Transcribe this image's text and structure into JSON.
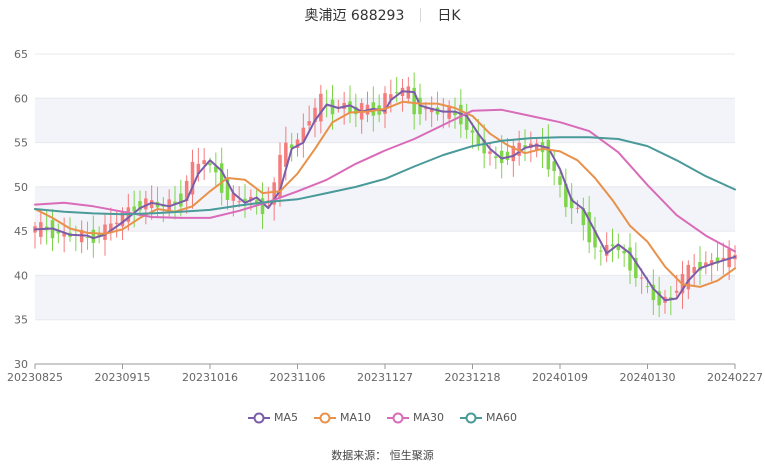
{
  "header": {
    "title": "奥浦迈 688293",
    "tab": "日K"
  },
  "source": "数据来源： 恒生聚源",
  "chart_data": {
    "type": "candlestick",
    "ylim": [
      30,
      65
    ],
    "yticks": [
      30,
      35,
      40,
      45,
      50,
      55,
      60,
      65
    ],
    "xticks": [
      "20230825",
      "20230915",
      "20231016",
      "20231106",
      "20231127",
      "20231218",
      "20240109",
      "20240130",
      "20240227"
    ],
    "xtick_index": [
      0,
      15,
      30,
      45,
      60,
      75,
      90,
      105,
      120
    ],
    "n_days": 121,
    "colors": {
      "up": "#f47c7c",
      "down": "#7ed54a",
      "ma5": "#7a5ca9",
      "ma10": "#e8914a",
      "ma30": "#d96bb9",
      "ma60": "#4a9a9a"
    },
    "series": [
      {
        "name": "MA5",
        "key": "ma5",
        "color": "#7a5ca9",
        "x": [
          0,
          3,
          6,
          9,
          10,
          12,
          15,
          18,
          20,
          23,
          26,
          28,
          30,
          32,
          34,
          36,
          38,
          40,
          42,
          44,
          46,
          48,
          50,
          52,
          54,
          56,
          58,
          60,
          61,
          63,
          65,
          66,
          68,
          70,
          72,
          74,
          76,
          78,
          80,
          82,
          84,
          86,
          88,
          90,
          92,
          94,
          96,
          98,
          100,
          102,
          104,
          106,
          108,
          110,
          112,
          114,
          116,
          118,
          120
        ],
        "y": [
          45.2,
          45.3,
          44.6,
          44.5,
          44.2,
          44.6,
          46.0,
          47.6,
          48.2,
          47.8,
          48.5,
          51.5,
          53.0,
          51.8,
          49.3,
          48.2,
          48.8,
          47.6,
          49.6,
          54.3,
          55.0,
          57.5,
          59.3,
          58.9,
          59.2,
          58.5,
          58.8,
          58.6,
          59.8,
          60.8,
          60.7,
          59.2,
          58.8,
          58.5,
          58.5,
          58.0,
          56.0,
          54.3,
          53.2,
          53.5,
          54.4,
          54.7,
          54.4,
          52.0,
          48.5,
          47.5,
          45.0,
          42.5,
          43.5,
          42.5,
          40.5,
          38.5,
          37.2,
          37.4,
          39.4,
          40.8,
          41.3,
          41.7,
          42.1
        ]
      },
      {
        "name": "MA10",
        "key": "ma10",
        "color": "#e8914a",
        "x": [
          0,
          3,
          6,
          9,
          12,
          15,
          18,
          21,
          24,
          27,
          30,
          33,
          36,
          39,
          42,
          45,
          48,
          51,
          54,
          57,
          60,
          63,
          66,
          69,
          72,
          75,
          78,
          81,
          84,
          87,
          90,
          93,
          96,
          99,
          102,
          105,
          108,
          111,
          114,
          117,
          120
        ],
        "y": [
          47.5,
          46.5,
          45.3,
          44.8,
          44.7,
          45.2,
          46.5,
          47.5,
          47.2,
          47.8,
          49.5,
          51.0,
          50.8,
          49.3,
          49.5,
          51.5,
          54.3,
          57.3,
          58.4,
          58.5,
          58.8,
          59.6,
          59.4,
          59.4,
          58.9,
          58.0,
          56.0,
          54.7,
          53.8,
          54.3,
          54.0,
          53.0,
          51.0,
          48.5,
          45.6,
          43.8,
          41.0,
          39.0,
          38.7,
          39.4,
          40.8
        ]
      },
      {
        "name": "MA30",
        "key": "ma30",
        "color": "#d96bb9",
        "x": [
          0,
          5,
          10,
          15,
          20,
          25,
          30,
          35,
          40,
          45,
          50,
          55,
          60,
          65,
          70,
          75,
          80,
          85,
          90,
          95,
          100,
          105,
          110,
          115,
          120
        ],
        "y": [
          48.0,
          48.2,
          47.8,
          47.2,
          46.6,
          46.5,
          46.5,
          47.3,
          48.3,
          49.5,
          50.8,
          52.6,
          54.1,
          55.4,
          57.0,
          58.6,
          58.7,
          58.0,
          57.3,
          56.3,
          53.9,
          50.2,
          46.8,
          44.5,
          42.7
        ]
      },
      {
        "name": "MA60",
        "key": "ma60",
        "color": "#4a9a9a",
        "x": [
          0,
          5,
          10,
          15,
          20,
          25,
          30,
          35,
          40,
          45,
          50,
          55,
          60,
          65,
          70,
          75,
          80,
          85,
          90,
          95,
          100,
          105,
          110,
          115,
          120
        ],
        "y": [
          47.5,
          47.2,
          47.0,
          46.9,
          47.0,
          47.2,
          47.4,
          47.9,
          48.3,
          48.6,
          49.3,
          50.0,
          50.9,
          52.3,
          53.6,
          54.6,
          55.2,
          55.5,
          55.6,
          55.6,
          55.4,
          54.6,
          53.0,
          51.2,
          49.7
        ]
      }
    ]
  }
}
